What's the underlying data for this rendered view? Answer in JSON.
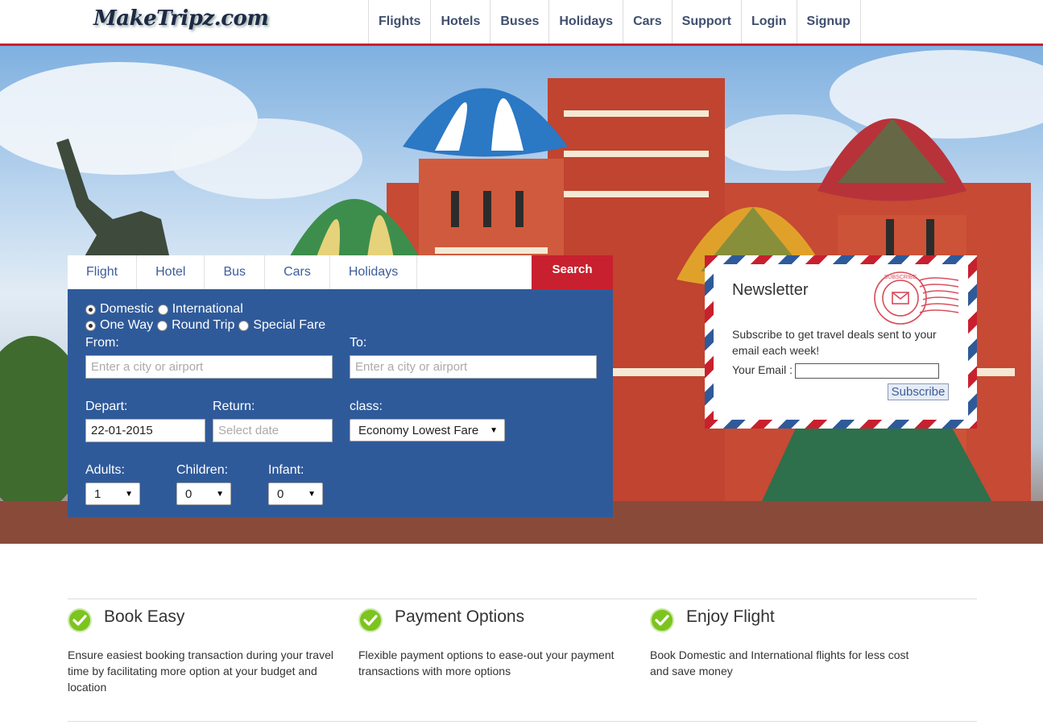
{
  "header": {
    "logo": "MakeTripz.com",
    "nav": [
      "Flights",
      "Hotels",
      "Buses",
      "Holidays",
      "Cars",
      "Support",
      "Login",
      "Signup"
    ]
  },
  "search": {
    "tabs": [
      "Flight",
      "Hotel",
      "Bus",
      "Cars",
      "Holidays"
    ],
    "search_label": "Search",
    "trip_scope": {
      "domestic": "Domestic",
      "international": "International",
      "selected": "Domestic"
    },
    "trip_type": {
      "one_way": "One Way",
      "round_trip": "Round Trip",
      "special_fare": "Special Fare",
      "selected": "One Way"
    },
    "from_label": "From:",
    "from_placeholder": "Enter a city or airport",
    "to_label": "To:",
    "to_placeholder": "Enter a city or airport",
    "depart_label": "Depart:",
    "depart_value": "22-01-2015",
    "return_label": "Return:",
    "return_placeholder": "Select date",
    "class_label": "class:",
    "class_value": "Economy Lowest Fare",
    "adults_label": "Adults:",
    "adults_value": "1",
    "children_label": "Children:",
    "children_value": "0",
    "infant_label": "Infant:",
    "infant_value": "0"
  },
  "newsletter": {
    "title": "Newsletter",
    "text": "Subscribe to get travel deals sent to your email each week!",
    "email_label": "Your Email :",
    "button": "Subscribe",
    "stamp_text": "SUBSCRIBE"
  },
  "features": [
    {
      "title": "Book Easy",
      "desc": "Ensure easiest booking transaction during your travel time by facilitating more option at your budget and location"
    },
    {
      "title": "Payment Options",
      "desc": "Flexible payment options to ease-out your payment transactions with more options"
    },
    {
      "title": "Enjoy Flight",
      "desc": "Book Domestic and International flights for less cost and save money"
    }
  ],
  "colors": {
    "brand_red": "#c8202f",
    "panel_blue": "#2f5a9a",
    "nav_text": "#3f4f6e",
    "check_green": "#7cc41f"
  },
  "icons": {
    "feature": "check-circle-icon",
    "select": "dropdown-arrow-icon"
  }
}
